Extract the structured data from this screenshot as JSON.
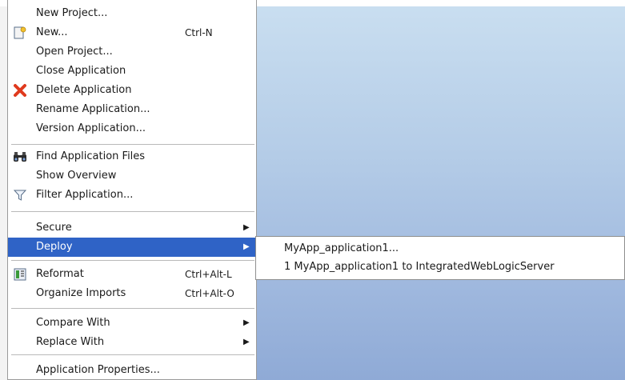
{
  "menu": {
    "items": [
      {
        "label": "New Project...",
        "accel": ""
      },
      {
        "label": "New...",
        "accel": "Ctrl-N",
        "icon": "new-gallery-icon"
      },
      {
        "label": "Open Project...",
        "accel": ""
      },
      {
        "label": "Close Application",
        "accel": ""
      },
      {
        "label": "Delete Application",
        "accel": "",
        "icon": "delete-x-icon"
      },
      {
        "label": "Rename Application...",
        "accel": ""
      },
      {
        "label": "Version Application...",
        "accel": ""
      },
      {
        "label": "Find Application Files",
        "accel": "",
        "icon": "binoculars-icon"
      },
      {
        "label": "Show Overview",
        "accel": ""
      },
      {
        "label": "Filter Application...",
        "accel": "",
        "icon": "filter-funnel-icon"
      },
      {
        "label": "Secure",
        "accel": "",
        "submenu": true
      },
      {
        "label": "Deploy",
        "accel": "",
        "submenu": true,
        "selected": true
      },
      {
        "label": "Reformat",
        "accel": "Ctrl+Alt-L",
        "icon": "reformat-icon"
      },
      {
        "label": "Organize Imports",
        "accel": "Ctrl+Alt-O"
      },
      {
        "label": "Compare With",
        "accel": "",
        "submenu": true
      },
      {
        "label": "Replace With",
        "accel": "",
        "submenu": true
      },
      {
        "label": "Application Properties...",
        "accel": ""
      }
    ]
  },
  "deploy_submenu": {
    "items": [
      {
        "label": "MyApp_application1..."
      },
      {
        "label": "1  MyApp_application1 to IntegratedWebLogicServer"
      }
    ]
  },
  "colors": {
    "highlight": "#2f63c6",
    "delete_icon": "#e03a1e",
    "background_gradient_top": "#c9def0",
    "background_gradient_bottom": "#8faad6"
  }
}
